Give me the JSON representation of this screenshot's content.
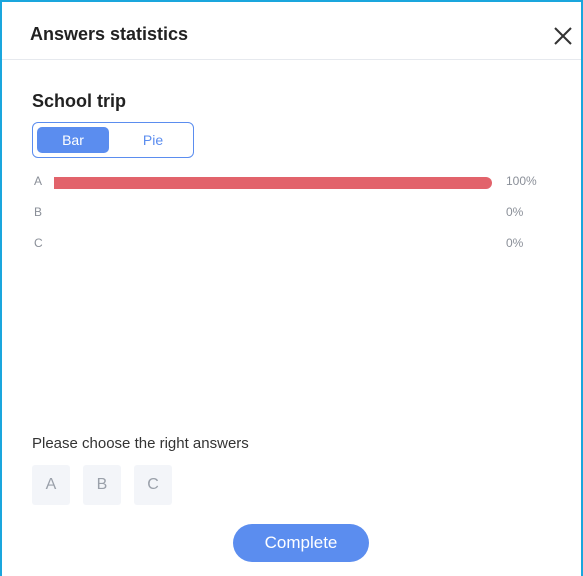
{
  "dialog": {
    "title": "Answers statistics"
  },
  "question": {
    "title": "School trip"
  },
  "view_toggle": {
    "bar_label": "Bar",
    "pie_label": "Pie",
    "selected": "Bar"
  },
  "chart_data": {
    "type": "bar",
    "categories": [
      "A",
      "B",
      "C"
    ],
    "values": [
      100,
      0,
      0
    ],
    "value_labels": [
      "100%",
      "0%",
      "0%"
    ],
    "ylim": [
      0,
      100
    ],
    "bar_color": "#e2636b",
    "orientation": "horizontal"
  },
  "answer_section": {
    "instruction": "Please choose the right answers",
    "options": [
      "A",
      "B",
      "C"
    ]
  },
  "footer": {
    "complete_label": "Complete"
  },
  "colors": {
    "accent": "#5b8def",
    "border": "#1aa6dd",
    "bar": "#e2636b"
  },
  "icons": {
    "close": "close-icon"
  }
}
